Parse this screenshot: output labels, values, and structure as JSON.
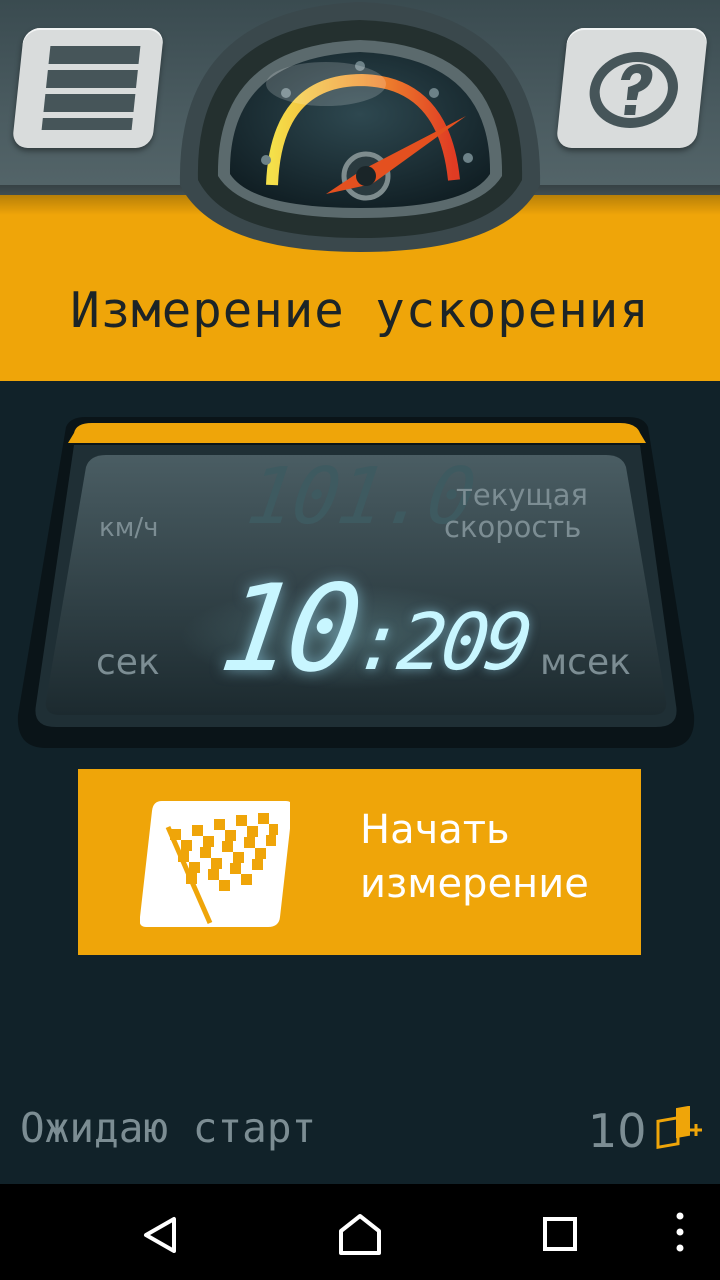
{
  "header": {
    "title": "Измерение ускорения",
    "menu_icon": "menu-icon",
    "help_icon": "help-icon",
    "gauge_icon": "speedometer-icon"
  },
  "display": {
    "speed_value": "101.0",
    "speed_unit": "км/ч",
    "speed_caption_line1": "текущая",
    "speed_caption_line2": "скорость",
    "seconds_value": "10",
    "seconds_unit": "сек",
    "milliseconds_value": ":209",
    "milliseconds_unit": "мсек"
  },
  "start_button": {
    "label_line1": "Начать",
    "label_line2": "измерение",
    "icon": "checkered-flag-icon"
  },
  "status": {
    "text": "Ожидаю старт",
    "satellite_count": "10",
    "icon": "gps-signal-icon"
  },
  "navbar": {
    "back_icon": "back-icon",
    "home_icon": "home-icon",
    "recents_icon": "recents-icon",
    "more_icon": "more-icon"
  },
  "colors": {
    "accent": "#efa509",
    "background": "#112229",
    "digit_glow": "#c8f6ff",
    "label_gray": "#7c8d93"
  }
}
